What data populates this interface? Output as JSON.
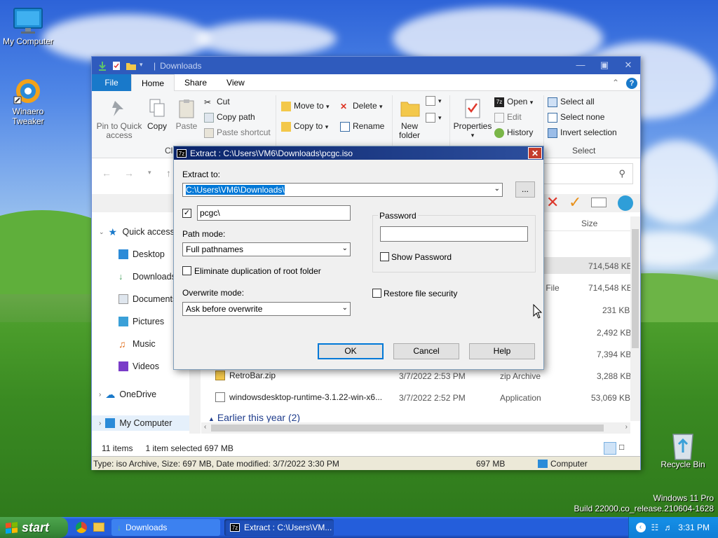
{
  "desktop": {
    "icons": [
      {
        "label": "My Computer"
      },
      {
        "label": "Winaero Tweaker"
      },
      {
        "label": "Recycle Bin"
      }
    ],
    "build_line1": "Windows 11 Pro",
    "build_line2": "Build 22000.co_release.210604-1628"
  },
  "explorer": {
    "title": "Downloads",
    "tabs": [
      "File",
      "Home",
      "Share",
      "View"
    ],
    "ribbon": {
      "pin_label_1": "Pin to Quick",
      "pin_label_2": "access",
      "copy": "Copy",
      "paste": "Paste",
      "cut": "Cut",
      "copy_path": "Copy path",
      "paste_shortcut": "Paste shortcut",
      "clipboard_group": "Cli",
      "move_to": "Move to",
      "copy_to": "Copy to",
      "delete": "Delete",
      "rename": "Rename",
      "new_folder_1": "New",
      "new_folder_2": "folder",
      "properties": "Properties",
      "open": "Open",
      "edit": "Edit",
      "history": "History",
      "select_all": "Select all",
      "select_none": "Select none",
      "invert_selection": "Invert selection",
      "select_group": "Select"
    },
    "nav": {
      "quick_access": "Quick access",
      "desktop": "Desktop",
      "downloads": "Downloads",
      "documents": "Documents",
      "pictures": "Pictures",
      "music": "Music",
      "videos": "Videos",
      "onedrive": "OneDrive",
      "my_computer": "My Computer"
    },
    "columns": {
      "size": "Size"
    },
    "files": [
      {
        "name": "",
        "date": "",
        "type": "",
        "size": "714,548 KB"
      },
      {
        "name": "",
        "date": "",
        "type": "OAD File",
        "size": "714,548 KB"
      },
      {
        "name": "",
        "date": "",
        "type": "",
        "size": "231 KB"
      },
      {
        "name": "",
        "date": "",
        "type": "",
        "size": "2,492 KB"
      },
      {
        "name": "",
        "date": "",
        "type": "",
        "size": "7,394 KB"
      },
      {
        "name": "RetroBar.zip",
        "date": "3/7/2022 2:53 PM",
        "type": "zip Archive",
        "size": "3,288 KB"
      },
      {
        "name": "windowsdesktop-runtime-3.1.22-win-x6...",
        "date": "3/7/2022 2:52 PM",
        "type": "Application",
        "size": "53,069 KB"
      }
    ],
    "group_header": "Earlier this year (2)",
    "status": {
      "items": "11 items",
      "selected": "1 item selected  697 MB",
      "details": "Type: iso Archive, Size: 697 MB, Date modified: 3/7/2022 3:30 PM",
      "size": "697 MB",
      "location": "Computer"
    }
  },
  "dialog": {
    "title": "Extract : C:\\Users\\VM6\\Downloads\\pcgc.iso",
    "extract_to_label": "Extract to:",
    "extract_to_value": "C:\\Users\\VM6\\Downloads\\",
    "browse_label": "...",
    "subfolder_value": "pcgc\\",
    "subfolder_checked": true,
    "path_mode_label": "Path mode:",
    "path_mode_value": "Full pathnames",
    "eliminate_label": "Eliminate duplication of root folder",
    "overwrite_label": "Overwrite mode:",
    "overwrite_value": "Ask before overwrite",
    "password_label": "Password",
    "show_password_label": "Show Password",
    "restore_security_label": "Restore file security",
    "ok": "OK",
    "cancel": "Cancel",
    "help": "Help"
  },
  "taskbar": {
    "start": "start",
    "buttons": [
      {
        "label": "Downloads"
      },
      {
        "label": "Extract : C:\\Users\\VM..."
      }
    ],
    "clock": "3:31 PM"
  },
  "colors": {
    "taskbar": "#245edb",
    "start": "#3c8f3c",
    "explorer_title": "#2f5bbd",
    "dialog_title": "#0a246a",
    "file_tab": "#1979ca",
    "selection": "#0078d7"
  }
}
